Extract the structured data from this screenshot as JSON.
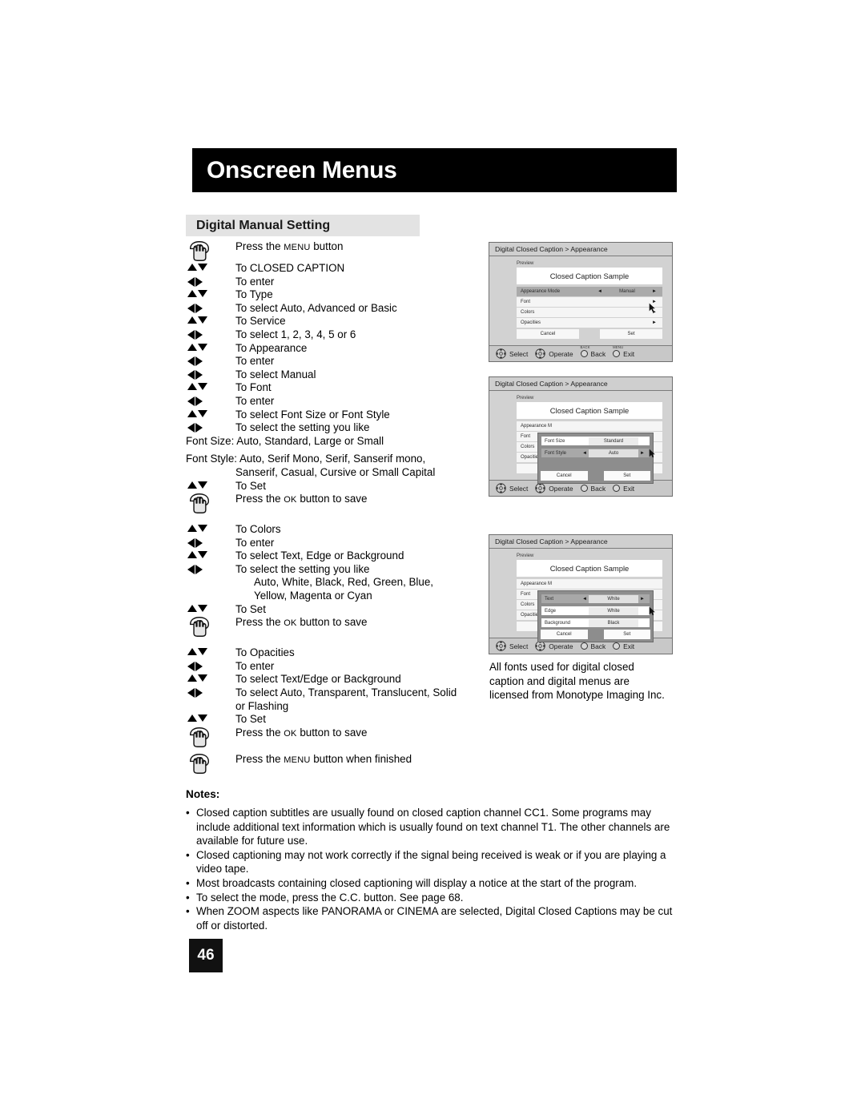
{
  "header": {
    "title": "Onscreen Menus"
  },
  "section": {
    "title": "Digital Manual Setting"
  },
  "steps": [
    {
      "icon": "hand",
      "text": "Press the MENU button",
      "smallcaps": "MENU",
      "prefix": "Press the ",
      "suffix": " button"
    },
    {
      "icon": "updown",
      "text": "To CLOSED CAPTION"
    },
    {
      "icon": "leftright",
      "text": "To enter"
    },
    {
      "icon": "updown",
      "text": "To Type"
    },
    {
      "icon": "leftright",
      "text": "To select Auto, Advanced or Basic"
    },
    {
      "icon": "updown",
      "text": "To Service"
    },
    {
      "icon": "leftright",
      "text": "To select 1, 2, 3, 4, 5 or 6"
    },
    {
      "icon": "updown",
      "text": "To Appearance"
    },
    {
      "icon": "leftright",
      "text": "To enter"
    },
    {
      "icon": "leftright",
      "text": "To select Manual"
    },
    {
      "icon": "updown",
      "text": "To Font"
    },
    {
      "icon": "leftright",
      "text": "To enter"
    },
    {
      "icon": "updown",
      "text": "To select Font Size or Font Style"
    },
    {
      "icon": "leftright",
      "text": "To select the setting you like"
    }
  ],
  "font_size_line": "Font Size: Auto, Standard, Large or Small",
  "font_style_line1": "Font Style: Auto, Serif Mono, Serif, Sanserif mono,",
  "font_style_line2": "Sanserif, Casual, Cursive or Small Capital",
  "steps2": [
    {
      "icon": "updown",
      "text": "To Set"
    },
    {
      "icon": "hand",
      "prefix": "Press the ",
      "smallcaps": "OK",
      "suffix": " button to save"
    }
  ],
  "steps3": [
    {
      "icon": "updown",
      "text": "To Colors"
    },
    {
      "icon": "leftright",
      "text": "To enter"
    },
    {
      "icon": "updown",
      "text": "To select Text, Edge or Background"
    },
    {
      "icon": "leftright",
      "text": "To select the setting you like"
    }
  ],
  "colors_line1": "Auto, White, Black, Red, Green, Blue,",
  "colors_line2": "Yellow, Magenta or Cyan",
  "steps4": [
    {
      "icon": "updown",
      "text": "To Set"
    },
    {
      "icon": "hand",
      "prefix": "Press the ",
      "smallcaps": "OK",
      "suffix": " button to save"
    }
  ],
  "steps5": [
    {
      "icon": "updown",
      "text": "To Opacities"
    },
    {
      "icon": "leftright",
      "text": "To enter"
    },
    {
      "icon": "updown",
      "text": "To select Text/Edge or Background"
    },
    {
      "icon": "leftright",
      "text": "To select Auto, Transparent, Translucent, Solid"
    }
  ],
  "opacities_cont": "or Flashing",
  "steps6": [
    {
      "icon": "updown",
      "text": "To Set"
    },
    {
      "icon": "hand",
      "prefix": "Press the ",
      "smallcaps": "OK",
      "suffix": " button to save"
    }
  ],
  "steps7": [
    {
      "icon": "hand",
      "prefix": "Press the ",
      "smallcaps": "MENU",
      "suffix": " button when finished"
    }
  ],
  "menus": [
    {
      "breadcrumb": "Digital Closed Caption  >  Appearance",
      "preview_label": "Preview",
      "sample_text": "Closed Caption Sample",
      "rows": [
        {
          "label": "Appearance Mode",
          "value": "Manual",
          "selected": true,
          "left_arrow": true,
          "right_arrow": true
        },
        {
          "label": "Font",
          "value": "",
          "selected": false,
          "left_arrow": false,
          "right_arrow": true
        },
        {
          "label": "Colors",
          "value": "",
          "selected": false,
          "left_arrow": false,
          "right_arrow": true
        },
        {
          "label": "Opacities",
          "value": "",
          "selected": false,
          "left_arrow": false,
          "right_arrow": true
        }
      ],
      "cancel_label": "Cancel",
      "set_label": "Set",
      "bottom": [
        {
          "icon": "dpad",
          "label": "Select",
          "mini": ""
        },
        {
          "icon": "dpad",
          "label": "Operate",
          "mini": ""
        },
        {
          "icon": "circle",
          "label": "Back",
          "mini": "BACK"
        },
        {
          "icon": "circle",
          "label": "Exit",
          "mini": "MENU"
        }
      ],
      "overlay": null
    },
    {
      "breadcrumb": "Digital Closed Caption  >  Appearance",
      "preview_label": "Preview",
      "sample_text": "Closed Caption Sample",
      "rows": [
        {
          "label": "Appearance M",
          "value": "",
          "selected": false,
          "left_arrow": false,
          "right_arrow": false
        },
        {
          "label": "Font",
          "value": "",
          "selected": false,
          "left_arrow": false,
          "right_arrow": false
        },
        {
          "label": "Colors",
          "value": "",
          "selected": false,
          "left_arrow": false,
          "right_arrow": false
        },
        {
          "label": "Opacities",
          "value": "",
          "selected": false,
          "left_arrow": false,
          "right_arrow": false
        }
      ],
      "cancel_label": "Cancel",
      "set_label": "Set",
      "bottom": [
        {
          "icon": "dpad",
          "label": "Select",
          "mini": ""
        },
        {
          "icon": "dpad",
          "label": "Operate",
          "mini": ""
        },
        {
          "icon": "circle",
          "label": "Back",
          "mini": "BACK"
        },
        {
          "icon": "circle",
          "label": "Exit",
          "mini": "MENU"
        }
      ],
      "overlay": {
        "rows": [
          {
            "label": "Font Size",
            "value": "Standard",
            "selected": false,
            "left_arrow": false,
            "right_arrow": false
          },
          {
            "label": "Font Style",
            "value": "Auto",
            "selected": true,
            "left_arrow": true,
            "right_arrow": true
          }
        ],
        "cancel_label": "Cancel",
        "set_label": "Set"
      }
    },
    {
      "breadcrumb": "Digital Closed Caption  >  Appearance",
      "preview_label": "Preview",
      "sample_text": "Closed Caption Sample",
      "rows": [
        {
          "label": "Appearance M",
          "value": "",
          "selected": false,
          "left_arrow": false,
          "right_arrow": false
        },
        {
          "label": "Font",
          "value": "",
          "selected": false,
          "left_arrow": false,
          "right_arrow": false
        },
        {
          "label": "Colors",
          "value": "",
          "selected": false,
          "left_arrow": false,
          "right_arrow": false
        },
        {
          "label": "Opacities",
          "value": "",
          "selected": false,
          "left_arrow": false,
          "right_arrow": false
        }
      ],
      "cancel_label": "Cancel",
      "set_label": "Set",
      "bottom": [
        {
          "icon": "dpad",
          "label": "Select",
          "mini": ""
        },
        {
          "icon": "dpad",
          "label": "Operate",
          "mini": ""
        },
        {
          "icon": "circle",
          "label": "Back",
          "mini": "BACK"
        },
        {
          "icon": "circle",
          "label": "Exit",
          "mini": "MENU"
        }
      ],
      "overlay": {
        "rows": [
          {
            "label": "Text",
            "value": "White",
            "selected": true,
            "left_arrow": true,
            "right_arrow": true
          },
          {
            "label": "Edge",
            "value": "White",
            "selected": false,
            "left_arrow": false,
            "right_arrow": false
          },
          {
            "label": "Background",
            "value": "Black",
            "selected": false,
            "left_arrow": false,
            "right_arrow": false
          }
        ],
        "cancel_label": "Cancel",
        "set_label": "Set"
      }
    }
  ],
  "right_paragraph": "All fonts used for digital closed caption and digital menus are licensed from Monotype Imaging Inc.",
  "notes": {
    "title": "Notes:",
    "items": [
      "Closed caption subtitles are usually found on closed caption channel CC1. Some programs may include additional text information which is usually found on text channel T1. The other channels are available for future use.",
      "Closed captioning may not work correctly if the signal being received is weak or if you are playing a video tape.",
      "Most broadcasts containing closed captioning will display a notice at the start of the program.",
      "To select the mode, press the C.C. button. See page 68.",
      "When ZOOM aspects like PANORAMA or CINEMA are selected, Digital Closed Captions may be cut off or distorted."
    ]
  },
  "page_number": "46",
  "colors": {
    "banner_bg": "#000000",
    "section_bg": "#e3e3e3",
    "menu_bg": "#d2d2d2",
    "selected_row": "#aaaaaa"
  }
}
